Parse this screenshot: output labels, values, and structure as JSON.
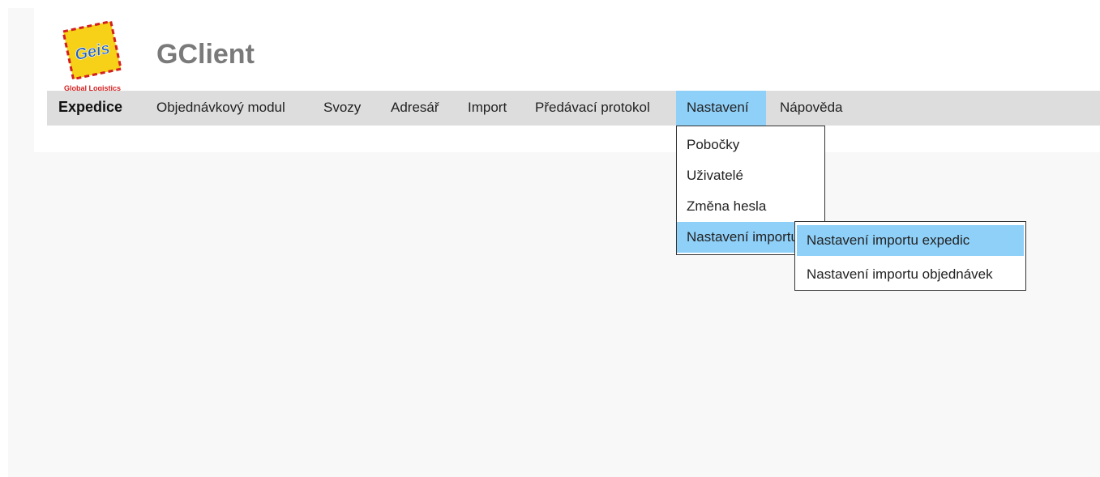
{
  "header": {
    "logo_text": "Geis",
    "logo_caption": "Global Logistics",
    "app_title": "GClient"
  },
  "menubar": {
    "items": [
      {
        "label": "Expedice"
      },
      {
        "label": "Objednávkový modul"
      },
      {
        "label": "Svozy"
      },
      {
        "label": "Adresář"
      },
      {
        "label": "Import"
      },
      {
        "label": "Předávací protokol"
      },
      {
        "label": "Nastavení"
      },
      {
        "label": "Nápověda"
      }
    ],
    "active": "Nastavení"
  },
  "dropdown": {
    "items": [
      {
        "label": "Pobočky"
      },
      {
        "label": "Uživatelé"
      },
      {
        "label": "Změna hesla"
      },
      {
        "label": "Nastavení importu"
      }
    ]
  },
  "submenu": {
    "items": [
      {
        "label": "Nastavení importu expedic"
      },
      {
        "label": "Nastavení importu objednávek"
      }
    ]
  },
  "colors": {
    "menubar_bg": "#dddddd",
    "highlight": "#8fd0f8",
    "logo_yellow": "#f7d117",
    "logo_red": "#d21f1f",
    "logo_blue": "#1f5fbf"
  }
}
